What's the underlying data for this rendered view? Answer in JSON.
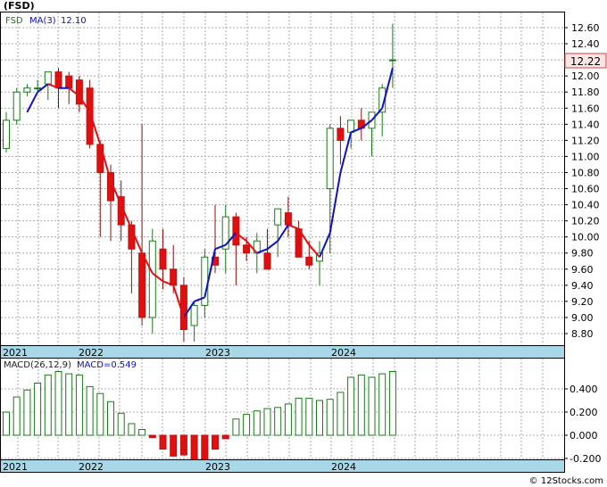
{
  "chart_data": [
    {
      "type": "candlestick",
      "title": "(FSD)",
      "legend": [
        {
          "label": "FSD",
          "color": "#1a7a1a"
        },
        {
          "label": "MA(3)",
          "color": "#1010c0"
        },
        {
          "label": "12.10",
          "color": "#1010c0"
        }
      ],
      "last_price_label": "12.22",
      "ylim": [
        8.6,
        12.8
      ],
      "yticks": [
        "12.60",
        "12.40",
        "12.20",
        "12.00",
        "11.80",
        "11.60",
        "11.40",
        "11.20",
        "11.00",
        "10.80",
        "10.60",
        "10.40",
        "10.20",
        "10.00",
        "9.80",
        "9.60",
        "9.40",
        "9.20",
        "9.00",
        "8.80"
      ],
      "xticks": [
        "2021",
        "2022",
        "2023",
        "2024"
      ],
      "x": [
        "2021-07",
        "2021-08",
        "2021-09",
        "2021-10",
        "2021-11",
        "2021-12",
        "2022-01",
        "2022-02",
        "2022-03",
        "2022-04",
        "2022-05",
        "2022-06",
        "2022-07",
        "2022-08",
        "2022-09",
        "2022-10",
        "2022-11",
        "2022-12",
        "2023-01",
        "2023-02",
        "2023-03",
        "2023-04",
        "2023-05",
        "2023-06",
        "2023-07",
        "2023-08",
        "2023-09",
        "2023-10",
        "2023-11",
        "2023-12",
        "2024-01",
        "2024-02",
        "2024-03",
        "2024-04",
        "2024-05",
        "2024-06",
        "2024-07",
        "2024-08"
      ],
      "open": [
        11.1,
        11.45,
        11.8,
        11.85,
        11.9,
        12.05,
        12.0,
        11.95,
        11.85,
        11.15,
        10.8,
        10.5,
        10.15,
        9.8,
        9.0,
        9.85,
        9.6,
        9.4,
        8.9,
        9.15,
        9.75,
        9.85,
        10.25,
        9.9,
        9.8,
        9.8,
        10.15,
        10.3,
        10.1,
        9.75,
        9.7,
        10.6,
        11.35,
        11.3,
        11.45,
        11.35,
        11.55,
        12.2
      ],
      "high": [
        11.55,
        11.85,
        11.9,
        11.95,
        12.05,
        12.1,
        12.05,
        12.0,
        11.95,
        11.2,
        10.9,
        10.7,
        10.2,
        11.4,
        10.1,
        10.1,
        9.9,
        9.5,
        9.2,
        9.85,
        10.4,
        10.4,
        10.3,
        10.0,
        10.05,
        10.1,
        10.35,
        10.5,
        10.2,
        9.95,
        9.95,
        11.4,
        11.5,
        11.45,
        11.6,
        11.5,
        11.9,
        12.65
      ],
      "low": [
        11.05,
        11.4,
        11.75,
        11.8,
        11.7,
        11.6,
        11.65,
        11.55,
        11.1,
        10.0,
        9.95,
        9.95,
        9.3,
        8.9,
        8.8,
        9.35,
        9.3,
        8.7,
        8.7,
        9.0,
        9.55,
        9.55,
        9.4,
        9.7,
        9.55,
        9.6,
        9.75,
        10.0,
        9.75,
        9.6,
        9.4,
        9.8,
        10.9,
        11.1,
        11.2,
        11.0,
        11.25,
        11.85
      ],
      "close": [
        11.45,
        11.8,
        11.85,
        11.85,
        12.05,
        11.85,
        11.85,
        11.65,
        11.15,
        10.8,
        10.45,
        10.15,
        9.85,
        9.0,
        9.95,
        9.6,
        9.4,
        8.85,
        9.15,
        9.75,
        9.65,
        10.25,
        9.9,
        9.8,
        9.95,
        9.6,
        10.35,
        10.15,
        9.75,
        9.65,
        9.8,
        11.35,
        11.2,
        11.45,
        11.35,
        11.55,
        11.85,
        12.2
      ],
      "ma3": [
        null,
        null,
        11.55,
        11.8,
        11.9,
        11.85,
        11.85,
        11.75,
        11.55,
        11.15,
        10.7,
        10.4,
        10.1,
        9.8,
        9.55,
        9.45,
        9.4,
        9.0,
        9.2,
        9.25,
        9.85,
        9.9,
        10.05,
        9.95,
        9.8,
        9.85,
        9.95,
        10.15,
        10.1,
        9.9,
        9.75,
        10.05,
        10.8,
        11.3,
        11.35,
        11.45,
        11.6,
        12.1
      ]
    },
    {
      "type": "bar",
      "legend": [
        {
          "label": "MACD(26,12,9)",
          "color": "#222222"
        },
        {
          "label": "MACD=0.549",
          "color": "#1010c0"
        }
      ],
      "ylim": [
        -0.25,
        0.65
      ],
      "yticks": [
        "0.400",
        "0.200",
        "0.000",
        "-0.200"
      ],
      "xticks": [
        "2021",
        "2022",
        "2023",
        "2024"
      ],
      "values": [
        0.2,
        0.33,
        0.39,
        0.45,
        0.52,
        0.55,
        0.53,
        0.52,
        0.42,
        0.36,
        0.29,
        0.19,
        0.1,
        0.05,
        -0.02,
        -0.12,
        -0.18,
        -0.17,
        -0.22,
        -0.23,
        -0.12,
        -0.03,
        0.14,
        0.18,
        0.21,
        0.23,
        0.24,
        0.27,
        0.32,
        0.32,
        0.3,
        0.31,
        0.37,
        0.5,
        0.52,
        0.5,
        0.53,
        0.55
      ]
    }
  ],
  "footer": {
    "copyright": "© 12Stocks.com"
  }
}
